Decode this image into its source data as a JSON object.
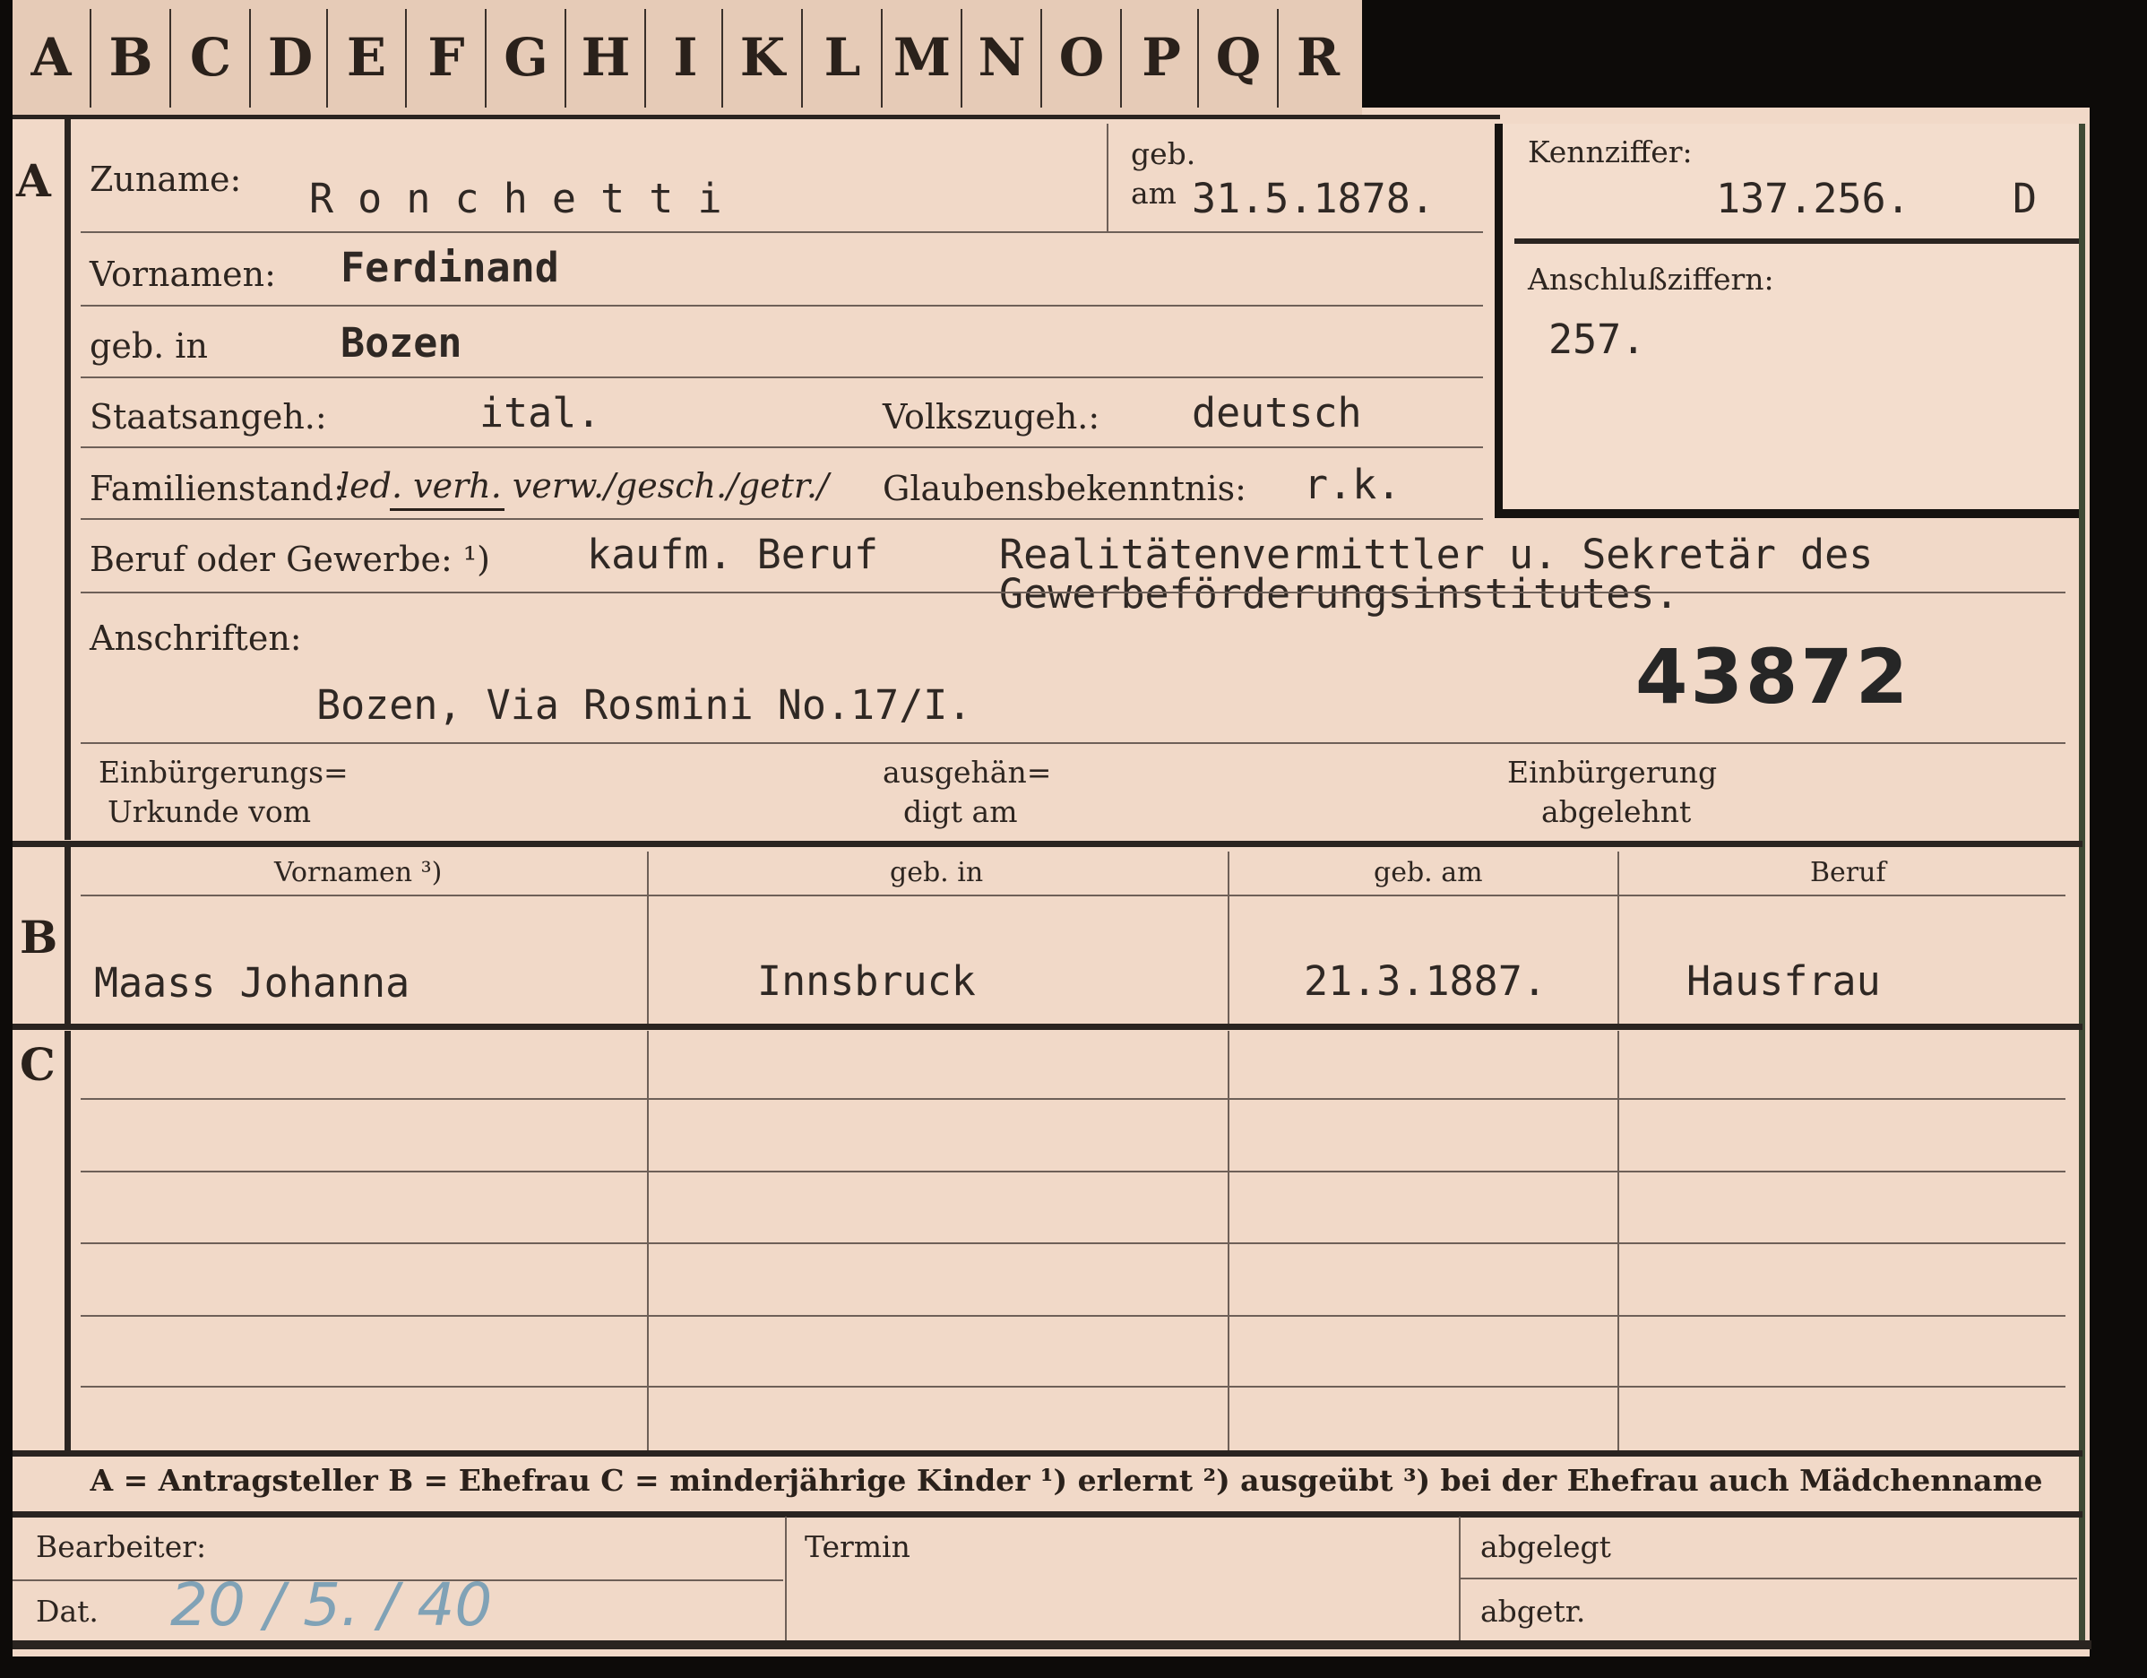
{
  "tabs": [
    "A",
    "B",
    "C",
    "D",
    "E",
    "F",
    "G",
    "H",
    "I",
    "K",
    "L",
    "M",
    "N",
    "O",
    "P",
    "Q",
    "R"
  ],
  "side_marks": {
    "a": "A",
    "b": "B",
    "c": "C"
  },
  "section_a": {
    "surname_label": "Zuname:",
    "surname_value": "R o n c h e t t i",
    "born_label_1": "geb.",
    "born_label_2": "am",
    "born_value": "31.5.1878.",
    "first_names_label": "Vornamen:",
    "first_names_value": "Ferdinand",
    "birthplace_label": "geb. in",
    "birthplace_value": "Bozen",
    "citizenship_label": "Staatsangeh.:",
    "citizenship_value": "ital.",
    "ethnicity_label": "Volkszugeh.:",
    "ethnicity_value": "deutsch",
    "family_status_label": "Familienstand:",
    "family_status_options": "led. verh. verw./gesch./getr./",
    "religion_label": "Glaubensbekenntnis:",
    "religion_value": "r.k.",
    "profession_label": "Beruf oder Gewerbe: ¹)",
    "profession_value": "kaufm. Beruf",
    "profession_detail_1": "Realitätenvermittler u. Sekretär des",
    "profession_detail_2": "Gewerbeförderungsinstitutes.",
    "address_label": "Anschriften:",
    "address_value": "Bozen, Via Rosmini No.17/I.",
    "stamp_number": "43872",
    "naturalization_label_1": "Einbürgerungs=",
    "naturalization_label_2": "Urkunde vom",
    "handed_label_1": "ausgehän=",
    "handed_label_2": "digt am",
    "rejected_label_1": "Einbürgerung",
    "rejected_label_2": "abgelehnt"
  },
  "id_box": {
    "kennziffer_label": "Kennziffer:",
    "kennziffer_value": "137.256.",
    "kennziffer_suffix": "D",
    "anschluss_label": "Anschlußziffern:",
    "anschluss_value": "257."
  },
  "section_b": {
    "headers": [
      "Vornamen ³)",
      "geb. in",
      "geb. am",
      "Beruf"
    ],
    "row": [
      "Maass  Johanna",
      "Innsbruck",
      "21.3.1887.",
      "Hausfrau"
    ]
  },
  "legend": "A = Antragsteller   B = Ehefrau   C = minderjährige Kinder   ¹) erlernt   ²) ausgeübt   ³) bei der Ehefrau auch Mädchenname",
  "footer": {
    "clerk_label": "Bearbeiter:",
    "date_label": "Dat.",
    "date_value": "20 / 5. / 40",
    "termin_label": "Termin",
    "filed_label": "abgelegt",
    "done_label": "abgetr."
  },
  "colors": {
    "paper": "#f1d9c8",
    "ink": "#2a211b",
    "pencil": "#6d99b4",
    "background": "#0d0b09"
  }
}
